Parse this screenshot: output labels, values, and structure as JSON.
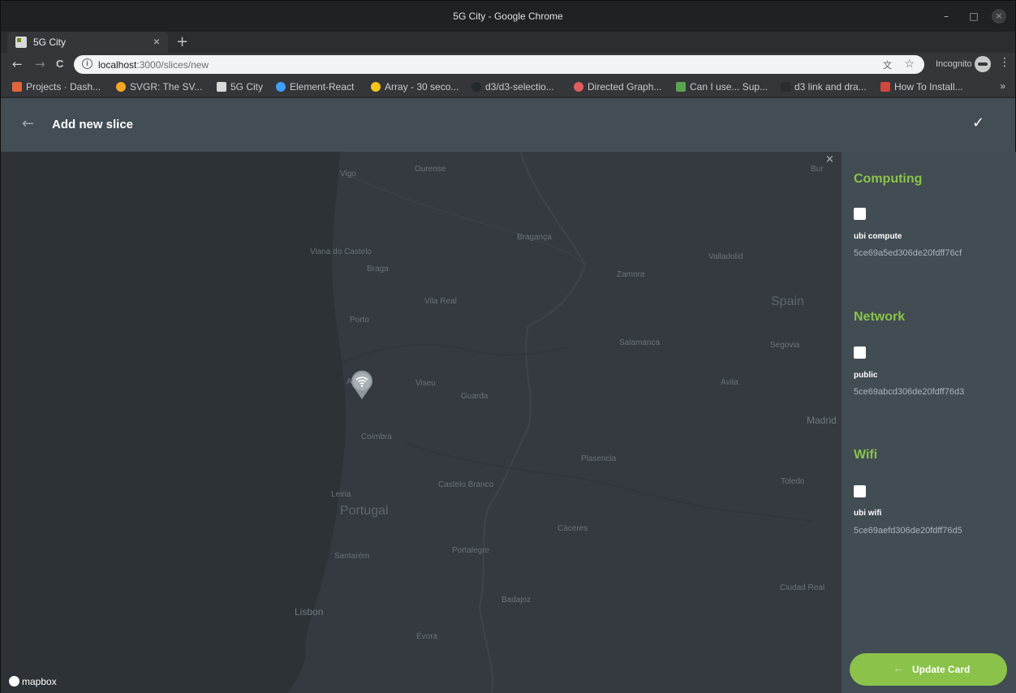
{
  "window": {
    "title": "5G City - Google Chrome",
    "min": "–",
    "max": "□",
    "close": "×"
  },
  "tab": {
    "label": "5G City",
    "close": "×",
    "new": "+"
  },
  "toolbar": {
    "back": "←",
    "forward": "→",
    "reload": "C",
    "info": "i",
    "url_host": "localhost",
    "url_path": ":3000/slices/new",
    "incognito_label": "Incognito",
    "translate": "文",
    "star": "☆",
    "menu": "⋮"
  },
  "bookmarks": [
    {
      "label": "Projects · Dash...",
      "color": "#e2643a"
    },
    {
      "label": "SVGR: The SV...",
      "color": "#f5a623"
    },
    {
      "label": "5G City",
      "color": "#d9d9d9"
    },
    {
      "label": "Element-React",
      "color": "#409eff"
    },
    {
      "label": "Array - 30 seco...",
      "color": "#f5c518"
    },
    {
      "label": "d3/d3-selectio...",
      "color": "#24292e"
    },
    {
      "label": "Directed Graph...",
      "color": "#e05d5d"
    },
    {
      "label": "Can I use... Sup...",
      "color": "#5aa34f"
    },
    {
      "label": "d3 link and dra...",
      "color": "#2b2d30"
    },
    {
      "label": "How To Install...",
      "color": "#d0473d"
    }
  ],
  "bookmarks_more": "»",
  "appbar": {
    "back": "←",
    "title": "Add new slice",
    "confirm": "✓"
  },
  "map": {
    "close": "×",
    "logo": "mapbox",
    "places": [
      {
        "name": "Vigo"
      },
      {
        "name": "Ourense"
      },
      {
        "name": "Bur"
      },
      {
        "name": "Bragança"
      },
      {
        "name": "Viana do Castelo"
      },
      {
        "name": "Braga"
      },
      {
        "name": "Valladolid"
      },
      {
        "name": "Zamora"
      },
      {
        "name": "Vila Real"
      },
      {
        "name": "Spain"
      },
      {
        "name": "Porto"
      },
      {
        "name": "Salamanca"
      },
      {
        "name": "Segovia"
      },
      {
        "name": "Viseu"
      },
      {
        "name": "Ávila"
      },
      {
        "name": "Guarda"
      },
      {
        "name": "Madrid"
      },
      {
        "name": "Coimbra"
      },
      {
        "name": "Plasencia"
      },
      {
        "name": "Toledo"
      },
      {
        "name": "Castelo Branco"
      },
      {
        "name": "Leiria"
      },
      {
        "name": "Portugal"
      },
      {
        "name": "Cáceres"
      },
      {
        "name": "Portalegre"
      },
      {
        "name": "Santarém"
      },
      {
        "name": "Ciudad Real"
      },
      {
        "name": "Badajoz"
      },
      {
        "name": "Lisbon"
      },
      {
        "name": "Évora"
      },
      {
        "name": "A"
      }
    ]
  },
  "panel": {
    "sections": [
      {
        "title": "Computing",
        "item_name": "ubi compute",
        "item_id": "5ce69a5ed306de20fdff76cf"
      },
      {
        "title": "Network",
        "item_name": "public",
        "item_id": "5ce69abcd306de20fdff76d3"
      },
      {
        "title": "Wifi",
        "item_name": "ubi wifi",
        "item_id": "5ce69aefd306de20fdff76d5"
      }
    ],
    "update_arrow": "←",
    "update_label": "Update Card"
  },
  "colors": {
    "accent": "#8bc34a",
    "appbar": "#424d54",
    "map": "#343a3f",
    "panel": "#414c53"
  }
}
